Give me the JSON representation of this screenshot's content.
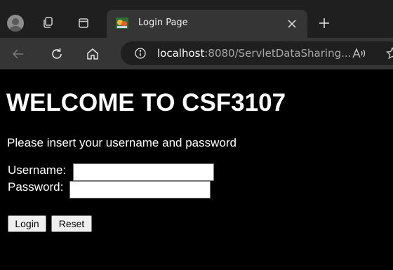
{
  "browser": {
    "tab": {
      "title": "Login Page",
      "favicon": "cartoon-favicon-icon"
    },
    "icons": {
      "profile": "profile-avatar-icon",
      "workspaces": "workspaces-icon",
      "tab_actions": "tab-actions-icon",
      "close": "close-icon",
      "new_tab": "plus-icon",
      "back": "back-arrow-icon",
      "refresh": "refresh-icon",
      "home": "home-icon",
      "info": "info-icon",
      "read_aloud": "read-aloud-icon"
    },
    "address": {
      "host": "localhost",
      "rest": ":8080/ServletDataSharing..."
    }
  },
  "page": {
    "heading": "WELCOME TO CSF3107",
    "instruction": "Please insert your username and password",
    "form": {
      "username_label": "Username:",
      "username_value": "",
      "password_label": "Password:",
      "password_value": "",
      "login_label": "Login",
      "reset_label": "Reset"
    }
  },
  "colors": {
    "page_background": "#000000",
    "page_text": "#ffffff",
    "tabbar": "#1f1f1f",
    "toolbar": "#353535"
  }
}
